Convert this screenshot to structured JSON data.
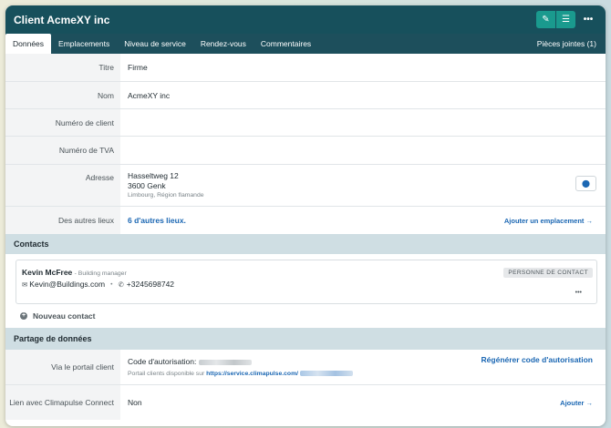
{
  "header": {
    "title": "Client AcmeXY inc",
    "edit_icon": "pencil-icon",
    "list_icon": "list-icon",
    "more": "•••"
  },
  "tabs": [
    "Données",
    "Emplacements",
    "Niveau de service",
    "Rendez-vous",
    "Commentaires"
  ],
  "attachments_tab": "Pièces jointes (1)",
  "fields": {
    "titre": {
      "label": "Titre",
      "value": "Firme"
    },
    "nom": {
      "label": "Nom",
      "value": "AcmeXY inc"
    },
    "numero_client": {
      "label": "Numéro de client",
      "value": ""
    },
    "numero_tva": {
      "label": "Numéro de TVA",
      "value": ""
    },
    "adresse": {
      "label": "Adresse",
      "line1": "Hasseltweg 12",
      "line2": "3600 Genk",
      "line3": "Limbourg, Région flamande"
    },
    "autres_lieux": {
      "label": "Des autres lieux",
      "value": "6 d'autres lieux.",
      "action": "Ajouter un emplacement →"
    }
  },
  "contacts": {
    "heading": "Contacts",
    "items": [
      {
        "name": "Kevin McFree",
        "role": "- Building manager",
        "email": "Kevin@Buildings.com",
        "phone": "+3245698742",
        "badge": "PERSONNE DE CONTACT",
        "more": "•••"
      }
    ],
    "new_contact": "Nouveau contact"
  },
  "partage": {
    "heading": "Partage de données",
    "portail": {
      "label": "Via le portail client",
      "code_label": "Code d'autorisation:",
      "regen": "Régénérer code d'autorisation",
      "note": "Portail clients disponible sur",
      "url": "https://service.climapulse.com/"
    },
    "lien": {
      "label": "Lien avec Climapulse Connect",
      "value": "Non",
      "action": "Ajouter →"
    }
  },
  "colors": {
    "header_bg": "#17505c",
    "accent_teal": "#1a9a8e",
    "link_blue": "#1b67b3",
    "section_bg": "#cfdee3"
  }
}
